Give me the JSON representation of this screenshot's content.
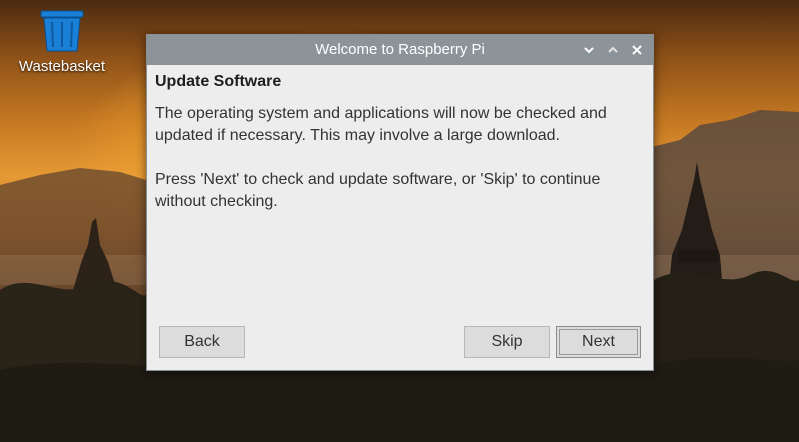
{
  "desktop": {
    "icons": [
      {
        "label": "Wastebasket",
        "icon": "wastebasket-icon"
      }
    ]
  },
  "window": {
    "title": "Welcome to Raspberry Pi",
    "controls": [
      "minimize-icon",
      "maximize-icon",
      "close-icon"
    ],
    "heading": "Update Software",
    "paragraphs": [
      "The operating system and applications will now be checked and updated if necessary. This may involve a large download.",
      "Press 'Next' to check and update software, or 'Skip' to continue without checking."
    ],
    "buttons": {
      "back": "Back",
      "skip": "Skip",
      "next": "Next"
    }
  },
  "colors": {
    "titlebar": "#8d9499",
    "window_bg": "#ededed",
    "button_bg": "#dcdcdc",
    "bin_blue": "#1a7fd6"
  }
}
